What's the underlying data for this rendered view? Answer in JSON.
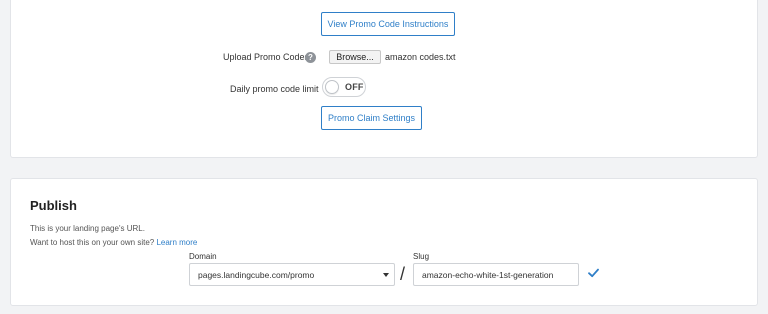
{
  "promo": {
    "instructions_button": "View Promo Code Instructions",
    "upload_label": "Upload Promo Codes",
    "help_glyph": "?",
    "browse_button": "Browse...",
    "file_name": "amazon codes.txt",
    "daily_limit_label": "Daily promo code limit",
    "daily_limit_toggle": "OFF",
    "claim_settings_button": "Promo Claim Settings"
  },
  "publish": {
    "title": "Publish",
    "description": "This is your landing page's URL.",
    "host_text": "Want to host this on your own site?",
    "learn_more": "Learn more",
    "domain_label": "Domain",
    "domain_value": "pages.landingcube.com/promo",
    "separator": "/",
    "slug_label": "Slug",
    "slug_value": "amazon-echo-white-1st-generation"
  },
  "icons": [
    "help-icon",
    "chevron-down-icon",
    "check-icon"
  ],
  "colors": {
    "accent": "#2f7fc8",
    "page_background": "#f2f3f5",
    "card_background": "#ffffff"
  }
}
